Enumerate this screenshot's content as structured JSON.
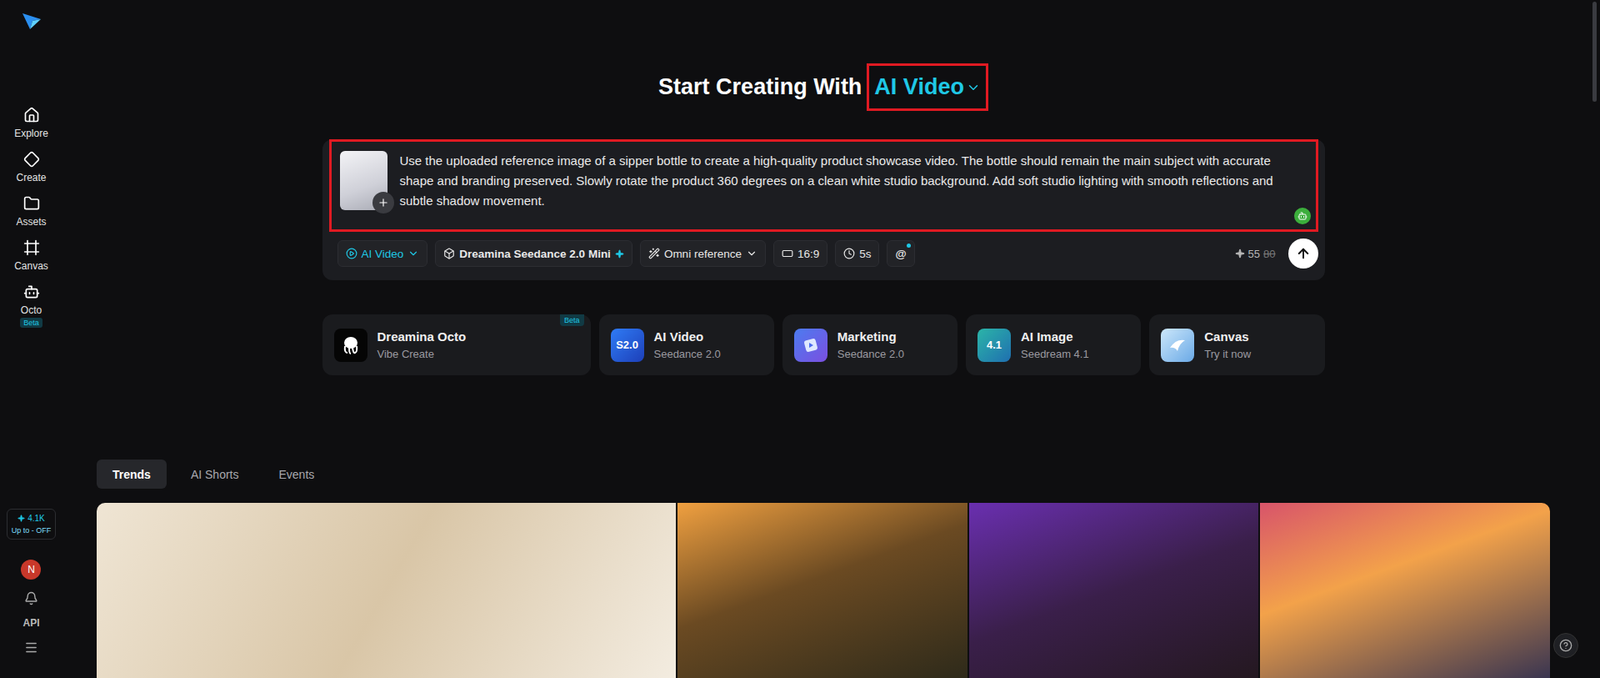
{
  "sidebar": {
    "items": [
      {
        "label": "Explore"
      },
      {
        "label": "Create"
      },
      {
        "label": "Assets"
      },
      {
        "label": "Canvas"
      },
      {
        "label": "Octo",
        "badge": "Beta"
      }
    ],
    "credits": {
      "amount": "4.1K",
      "promo": "Up to - OFF"
    },
    "avatar": "N",
    "api": "API"
  },
  "hero": {
    "title": "Start Creating With",
    "mode": "AI Video"
  },
  "prompt": {
    "text": "Use the uploaded reference image of a sipper bottle to create a high-quality product showcase video. The bottle should remain the main subject with accurate shape and branding preserved. Slowly rotate the product 360 degrees on a clean white studio background. Add soft studio lighting with smooth reflections and subtle shadow movement.",
    "toolbar": [
      {
        "label": "AI Video",
        "kind": "mode",
        "dropdown": true
      },
      {
        "label": "Dreamina Seedance 2.0 Mini",
        "kind": "model",
        "dropdown": false
      },
      {
        "label": "Omni reference",
        "kind": "reference",
        "dropdown": true
      },
      {
        "label": "16:9",
        "kind": "ratio",
        "dropdown": false
      },
      {
        "label": "5s",
        "kind": "duration",
        "dropdown": false
      },
      {
        "label": "@",
        "kind": "mention",
        "dropdown": false
      }
    ],
    "cost": "55",
    "original_cost": "80"
  },
  "shortcuts": [
    {
      "title": "Dreamina Octo",
      "subtitle": "Vibe Create",
      "badge": "Beta"
    },
    {
      "title": "AI Video",
      "subtitle": "Seedance 2.0",
      "icon_text": "S2.0"
    },
    {
      "title": "Marketing",
      "subtitle": "Seedance 2.0"
    },
    {
      "title": "AI Image",
      "subtitle": "Seedream 4.1",
      "icon_text": "4.1"
    },
    {
      "title": "Canvas",
      "subtitle": "Try it now"
    }
  ],
  "tabs": [
    {
      "label": "Trends",
      "selected": true
    },
    {
      "label": "AI Shorts",
      "selected": false
    },
    {
      "label": "Events",
      "selected": false
    }
  ]
}
